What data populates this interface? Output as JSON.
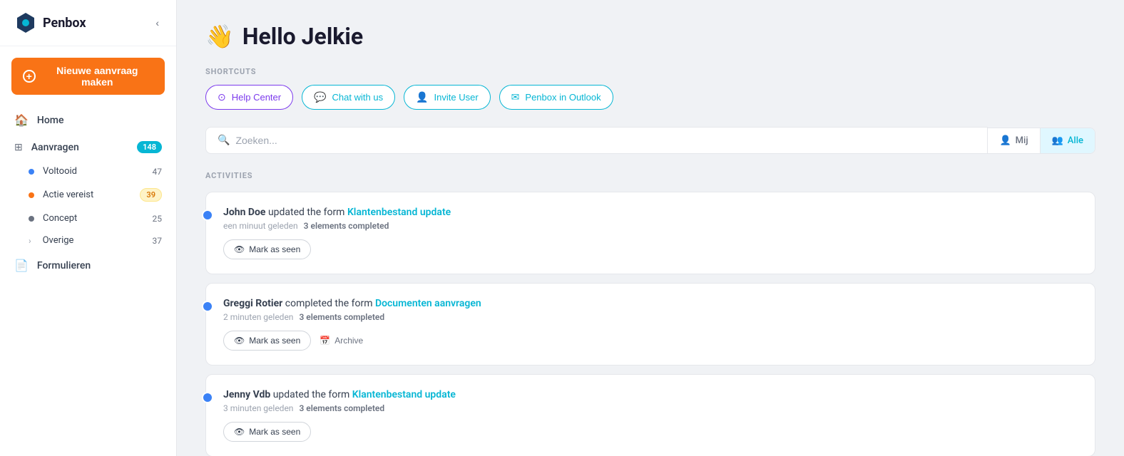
{
  "app": {
    "name": "Penbox",
    "collapse_icon": "‹"
  },
  "sidebar": {
    "new_request_label": "Nieuwe aanvraag maken",
    "nav_items": [
      {
        "id": "home",
        "label": "Home",
        "icon": "🏠",
        "badge": null
      },
      {
        "id": "aanvragen",
        "label": "Aanvragen",
        "icon": "⊞",
        "badge": "148"
      }
    ],
    "sub_nav_items": [
      {
        "id": "voltooid",
        "label": "Voltooid",
        "dot_color": "blue",
        "count": "47"
      },
      {
        "id": "actie-vereist",
        "label": "Actie vereist",
        "dot_color": "orange",
        "count": "39",
        "badge_type": "pill"
      },
      {
        "id": "concept",
        "label": "Concept",
        "dot_color": "gray",
        "count": "25"
      },
      {
        "id": "overige",
        "label": "Overige",
        "dot_color": "none",
        "count": "37",
        "has_chevron": true
      }
    ],
    "bottom_nav": [
      {
        "id": "formulieren",
        "label": "Formulieren",
        "icon": "📄"
      }
    ]
  },
  "header": {
    "wave_emoji": "👋",
    "title": "Hello Jelkie"
  },
  "shortcuts": {
    "label": "SHORTCUTS",
    "buttons": [
      {
        "id": "help-center",
        "label": "Help Center",
        "icon": "help",
        "style": "purple"
      },
      {
        "id": "chat-with-us",
        "label": "Chat with us",
        "icon": "chat",
        "style": "teal"
      },
      {
        "id": "invite-user",
        "label": "Invite User",
        "icon": "user-plus",
        "style": "cyan"
      },
      {
        "id": "penbox-outlook",
        "label": "Penbox in Outlook",
        "icon": "mail",
        "style": "cyan"
      }
    ]
  },
  "search": {
    "placeholder": "Zoeken..."
  },
  "filter_tabs": [
    {
      "id": "mij",
      "label": "Mij",
      "icon": "person",
      "active": false
    },
    {
      "id": "alle",
      "label": "Alle",
      "icon": "people",
      "active": true
    }
  ],
  "activities": {
    "label": "ACTIVITIES",
    "items": [
      {
        "id": "activity-1",
        "name": "John Doe",
        "action": "updated the form",
        "form_link": "Klantenbestand update",
        "time": "een minuut geleden",
        "elements": "3 elements completed",
        "actions": [
          "mark-as-seen"
        ]
      },
      {
        "id": "activity-2",
        "name": "Greggi Rotier",
        "action": "completed the form",
        "form_link": "Documenten aanvragen",
        "time": "2 minuten geleden",
        "elements": "3 elements completed",
        "actions": [
          "mark-as-seen",
          "archive"
        ]
      },
      {
        "id": "activity-3",
        "name": "Jenny Vdb",
        "action": "updated the form",
        "form_link": "Klantenbestand update",
        "time": "3 minuten geleden",
        "elements": "3 elements completed",
        "actions": [
          "mark-as-seen"
        ]
      }
    ],
    "mark_as_seen_label": "Mark as seen",
    "archive_label": "Archive"
  }
}
